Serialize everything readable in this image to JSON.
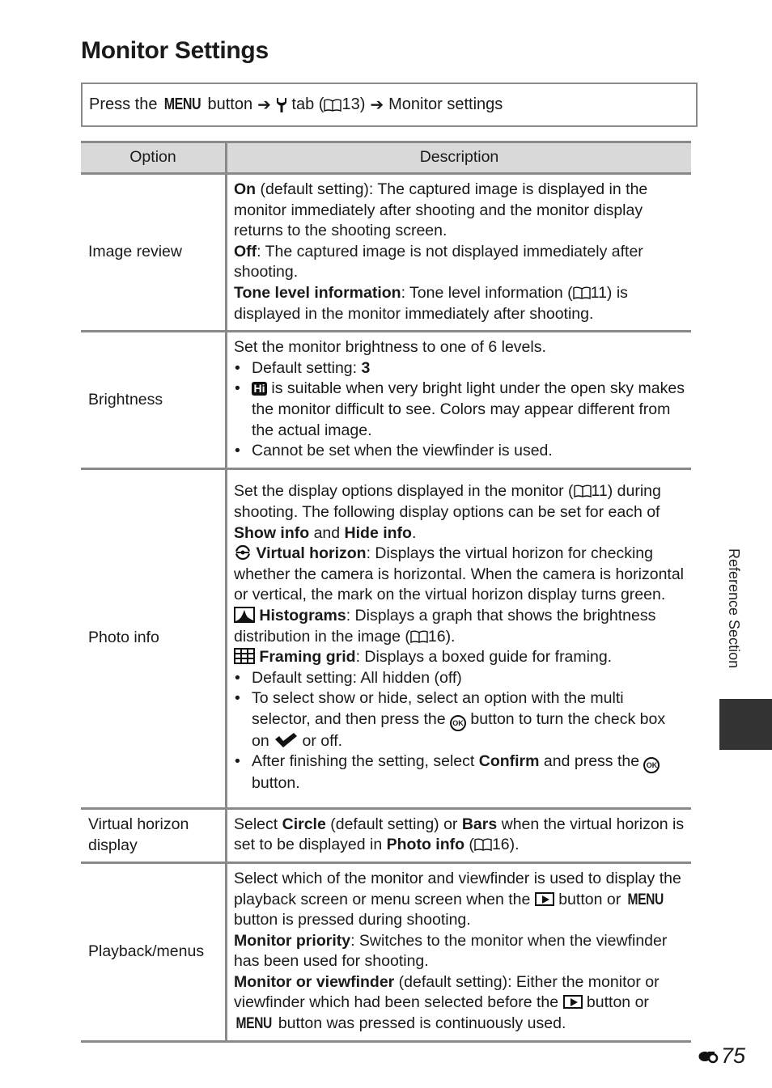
{
  "page": {
    "title": "Monitor Settings",
    "navigation": {
      "prefix": "Press the ",
      "menu_button": "MENU",
      "after_menu": " button",
      "tab_text": " tab (",
      "tab_ref": "13)",
      "destination": "Monitor settings",
      "icons": [
        "arrow-right-icon",
        "wrench-icon",
        "book-icon",
        "arrow-right-icon"
      ]
    },
    "side_label": "Reference Section",
    "page_number": "75",
    "accent_color": "#333333",
    "rule_color": "#8a8a8a",
    "header_fill": "#d9d9d9"
  },
  "table": {
    "headers": {
      "option": "Option",
      "description": "Description"
    },
    "rows": [
      {
        "option": "Image review",
        "paragraphs": [
          {
            "bold": "On",
            "text": " (default setting): The captured image is displayed in the monitor immediately after shooting and the monitor display returns to the shooting screen."
          },
          {
            "bold": "Off",
            "text": ": The captured image is not displayed immediately after shooting."
          },
          {
            "bold": "Tone level information",
            "text": ": Tone level information (",
            "ref": "11) is displayed in the monitor immediately after shooting."
          }
        ]
      },
      {
        "option": "Brightness",
        "intro": "Set the monitor brightness to one of 6 levels.",
        "bullets": [
          {
            "text": "Default setting: ",
            "bold": "3"
          },
          {
            "icon": "Hi",
            "text": " is suitable when very bright light under the open sky makes the monitor difficult to see. Colors may appear different from the actual image."
          },
          {
            "text": "Cannot be set when the viewfinder is used."
          }
        ]
      },
      {
        "option": "Photo info",
        "intro": {
          "a": "Set the display options displayed in the monitor (",
          "ref": "11)",
          "b": " during shooting. The following display options can be set for each of ",
          "bold1": "Show info",
          "c": " and ",
          "bold2": "Hide info",
          "d": "."
        },
        "items": [
          {
            "icon": "virtual-horizon-icon",
            "bold": "Virtual horizon",
            "text": ": Displays the virtual horizon for checking whether the camera is horizontal. When the camera is horizontal or vertical, the mark on the virtual horizon display turns green."
          },
          {
            "icon": "histogram-icon",
            "bold": "Histograms",
            "text": ": Displays a graph that shows the brightness distribution in the image (",
            "ref": "16)."
          },
          {
            "icon": "framing-grid-icon",
            "bold": "Framing grid",
            "text": ": Displays a boxed guide for framing."
          }
        ],
        "bullets": [
          {
            "text": "Default setting: All hidden (off)"
          },
          {
            "a": "To select show or hide, select an option with the multi selector, and then press the ",
            "ok": "OK",
            "b": " button to turn the check box on ",
            "c": " or off."
          },
          {
            "a": "After finishing the setting, select ",
            "bold": "Confirm",
            "b": " and press the ",
            "ok": "OK",
            "c": " button."
          }
        ]
      },
      {
        "option": "Virtual horizon display",
        "parts": {
          "a": "Select ",
          "bold1": "Circle",
          "b": " (default setting) or ",
          "bold2": "Bars",
          "c": " when the virtual horizon is set to be displayed in ",
          "bold3": "Photo info",
          "d": " (",
          "ref": "16)."
        }
      },
      {
        "option": "Playback/menus",
        "intro": {
          "a": "Select which of the monitor and viewfinder is used to display the playback screen or menu screen when the ",
          "b": " button or ",
          "menu": "MENU",
          "c": " button is pressed during shooting."
        },
        "paragraphs": [
          {
            "bold": "Monitor priority",
            "text": ": Switches to the monitor when the viewfinder has been used for shooting."
          },
          {
            "bold": "Monitor or viewfinder",
            "a": " (default setting): Either the monitor or viewfinder which had been selected before the ",
            "b": " button or ",
            "menu": "MENU",
            "c": " button was pressed is continuously used."
          }
        ]
      }
    ]
  }
}
